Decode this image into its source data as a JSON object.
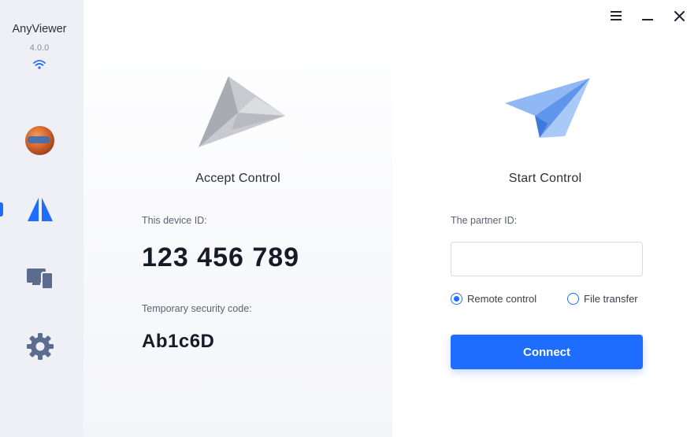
{
  "app": {
    "name": "AnyViewer",
    "version": "4.0.0"
  },
  "sidebar": {
    "items": [
      {
        "name": "profile",
        "icon": "avatar"
      },
      {
        "name": "connect",
        "icon": "connect-icon",
        "active": true
      },
      {
        "name": "devices",
        "icon": "devices-icon"
      },
      {
        "name": "settings",
        "icon": "gear-icon"
      }
    ]
  },
  "titlebar": {
    "menu_icon": "menu-icon",
    "minimize_icon": "minimize-icon",
    "close_icon": "close-icon"
  },
  "accept": {
    "title": "Accept Control",
    "device_id_label": "This device ID:",
    "device_id": "123 456 789",
    "security_label": "Temporary security code:",
    "security_code": "Ab1c6D"
  },
  "start": {
    "title": "Start Control",
    "partner_label": "The partner ID:",
    "partner_value": "",
    "options": [
      {
        "label": "Remote control",
        "checked": true
      },
      {
        "label": "File transfer",
        "checked": false
      }
    ],
    "connect_label": "Connect"
  },
  "colors": {
    "accent": "#1f6dff",
    "sidebar_bg": "#eef0f5"
  }
}
